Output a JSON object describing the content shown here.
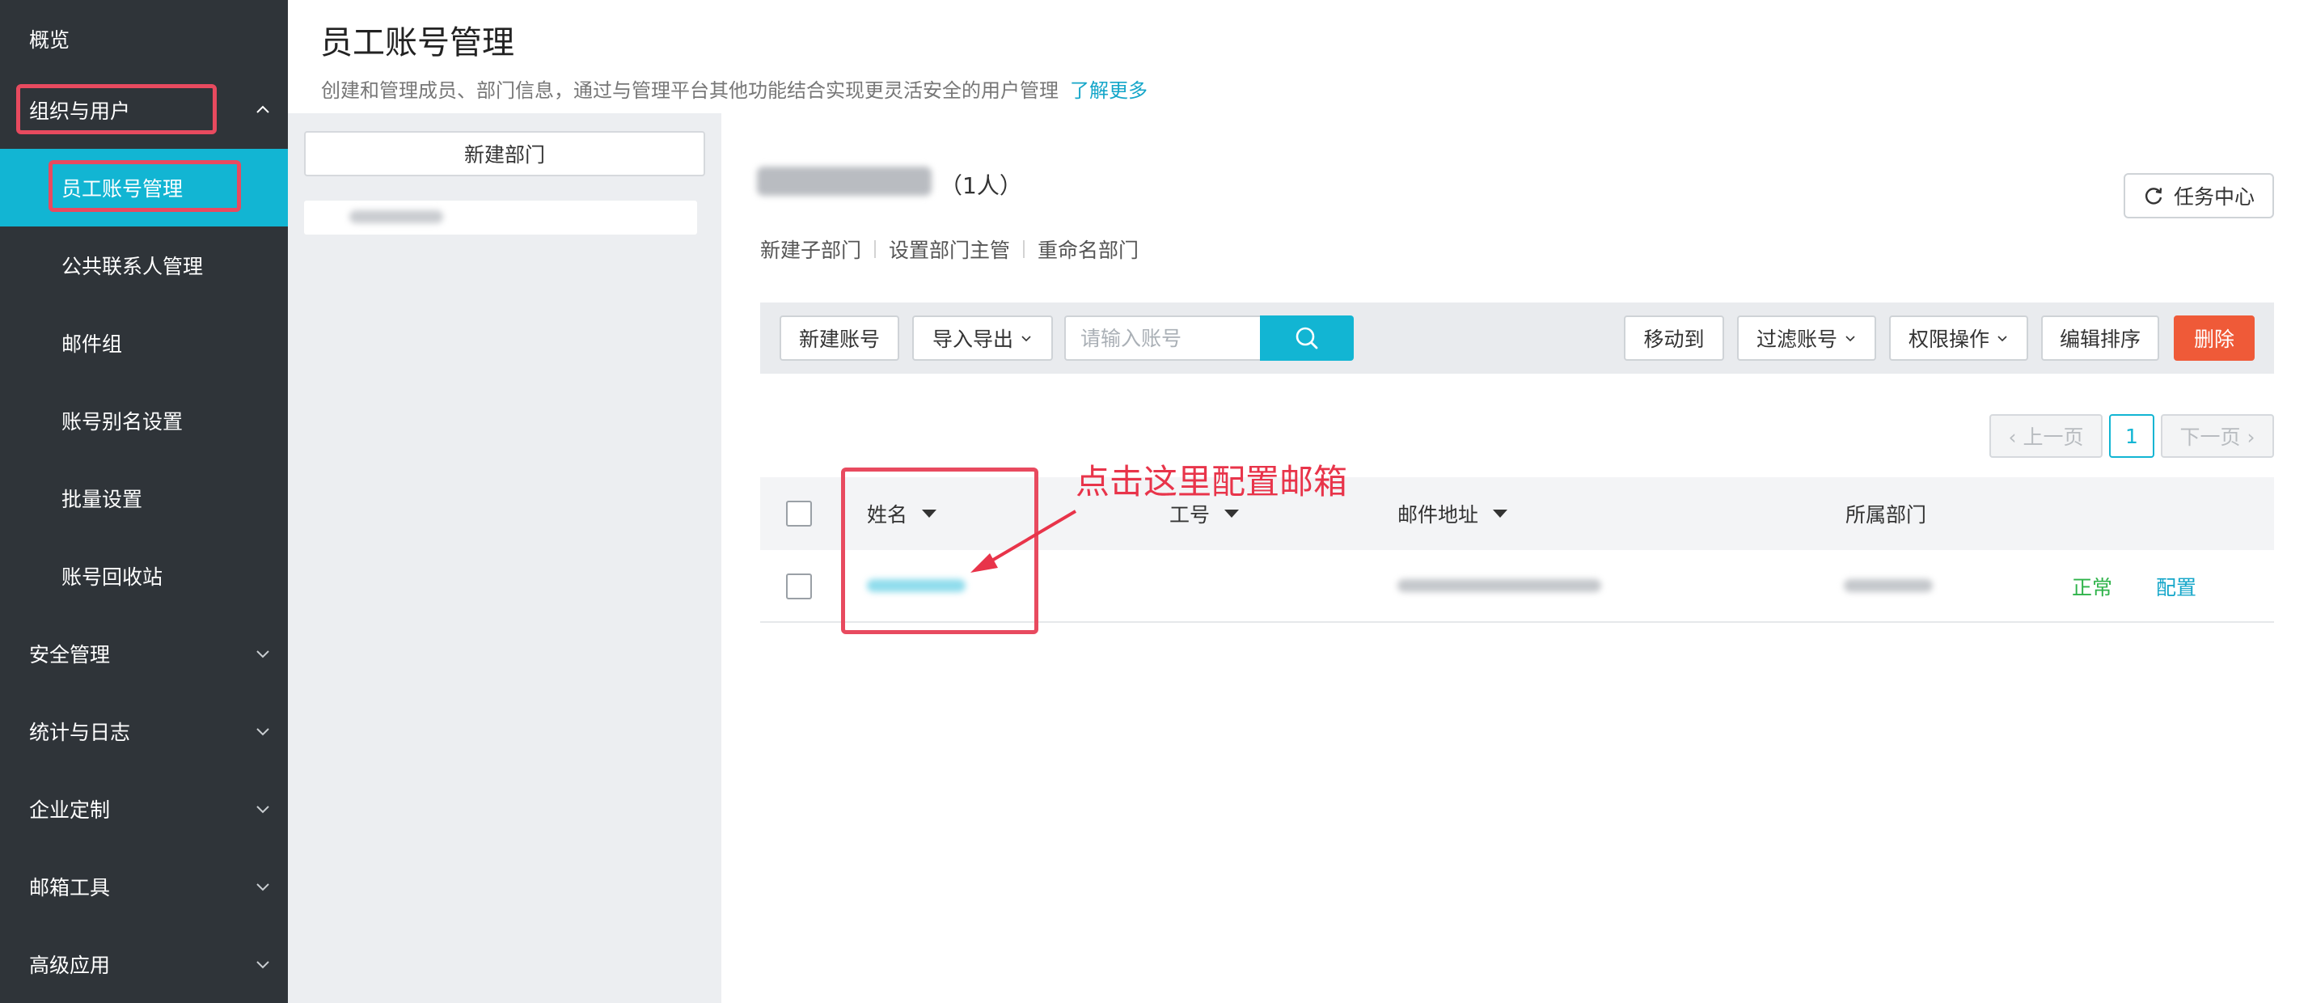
{
  "sidebar": {
    "items": [
      {
        "label": "概览",
        "expandable": false
      },
      {
        "label": "组织与用户",
        "expandable": true,
        "expanded": true
      },
      {
        "label": "员工账号管理",
        "sub": true,
        "active": true
      },
      {
        "label": "公共联系人管理",
        "sub": true
      },
      {
        "label": "邮件组",
        "sub": true
      },
      {
        "label": "账号别名设置",
        "sub": true
      },
      {
        "label": "批量设置",
        "sub": true
      },
      {
        "label": "账号回收站",
        "sub": true
      },
      {
        "label": "安全管理",
        "expandable": true
      },
      {
        "label": "统计与日志",
        "expandable": true
      },
      {
        "label": "企业定制",
        "expandable": true
      },
      {
        "label": "邮箱工具",
        "expandable": true
      },
      {
        "label": "高级应用",
        "expandable": true
      }
    ]
  },
  "header": {
    "title": "员工账号管理",
    "description": "创建和管理成员、部门信息，通过与管理平台其他功能结合实现更灵活安全的用户管理",
    "learn_more": "了解更多"
  },
  "dept_panel": {
    "new_dept_label": "新建部门"
  },
  "dept": {
    "count": "（1人）",
    "actions": [
      "新建子部门",
      "设置部门主管",
      "重命名部门"
    ],
    "task_center": "任务中心"
  },
  "toolbar": {
    "new_account": "新建账号",
    "import_export": "导入导出",
    "search_placeholder": "请输入账号",
    "move_to": "移动到",
    "filter": "过滤账号",
    "permissions": "权限操作",
    "sort": "编辑排序",
    "delete": "删除"
  },
  "pagination": {
    "prev": "‹ 上一页",
    "current": "1",
    "next": "下一页 ›"
  },
  "table": {
    "headers": [
      "姓名",
      "工号",
      "邮件地址",
      "所属部门"
    ],
    "rows": [
      {
        "status": "正常",
        "action": "配置"
      }
    ]
  },
  "annotation": {
    "text": "点击这里配置邮箱",
    "color": "#e8344a"
  },
  "colors": {
    "accent": "#12b5d3",
    "sidebar_bg": "#2f3439",
    "danger": "#ef5a38",
    "status_ok": "#2fb34a"
  }
}
